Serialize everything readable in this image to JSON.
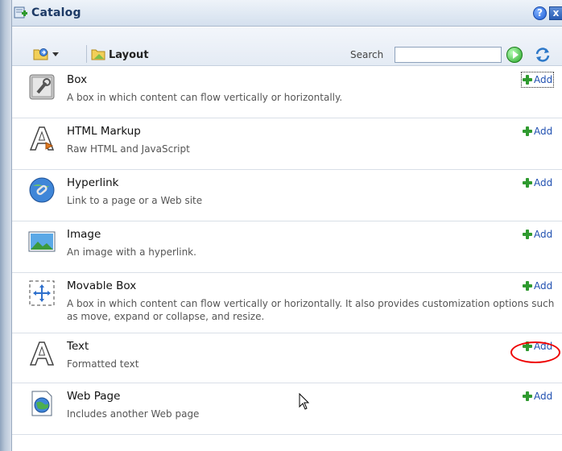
{
  "window": {
    "title": "Catalog",
    "help_label": "?",
    "close_label": "x"
  },
  "toolbar": {
    "layout_label": "Layout",
    "search_label": "Search",
    "search_value": "",
    "search_placeholder": ""
  },
  "items": [
    {
      "title": "Box",
      "description": "A box in which content can flow vertically or horizontally.",
      "add_label": "Add",
      "icon": "box-icon"
    },
    {
      "title": "HTML Markup",
      "description": "Raw HTML and JavaScript",
      "add_label": "Add",
      "icon": "html-markup-icon"
    },
    {
      "title": "Hyperlink",
      "description": "Link to a page or a Web site",
      "add_label": "Add",
      "icon": "hyperlink-icon"
    },
    {
      "title": "Image",
      "description": "An image with a hyperlink.",
      "add_label": "Add",
      "icon": "image-icon"
    },
    {
      "title": "Movable Box",
      "description": "A box in which content can flow vertically or horizontally. It also provides customization options such as move, expand or collapse, and resize.",
      "add_label": "Add",
      "icon": "movable-box-icon"
    },
    {
      "title": "Text",
      "description": "Formatted text",
      "add_label": "Add",
      "icon": "text-icon"
    },
    {
      "title": "Web Page",
      "description": "Includes another Web page",
      "add_label": "Add",
      "icon": "web-page-icon"
    }
  ],
  "colors": {
    "title_text": "#1d3a66",
    "add_plus": "#2f9a2f",
    "callout_circle": "#ee0000"
  }
}
